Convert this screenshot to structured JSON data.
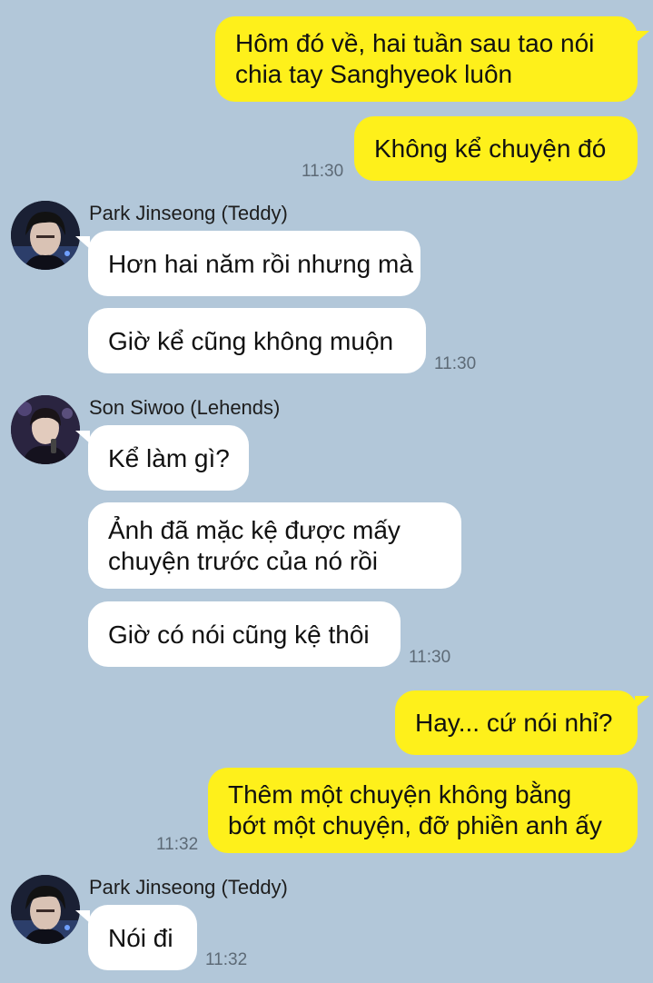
{
  "messages": [
    {
      "text": "Hôm đó về, hai tuần sau tao nói\nchia tay Sanghyeok luôn"
    },
    {
      "text": "Không kể chuyện đó",
      "time": "11:30"
    },
    {
      "sender": "Park Jinseong (Teddy)",
      "text": "Hơn hai năm rồi nhưng mà"
    },
    {
      "text": "Giờ kể cũng không muộn",
      "time": "11:30"
    },
    {
      "sender": "Son Siwoo (Lehends)",
      "text": "Kể làm gì?"
    },
    {
      "text": "Ảnh đã mặc kệ được mấy\nchuyện trước của nó rồi"
    },
    {
      "text": "Giờ có nói cũng kệ thôi",
      "time": "11:30"
    },
    {
      "text": "Hay... cứ nói nhỉ?"
    },
    {
      "text": "Thêm một chuyện không bằng\nbớt một chuyện, đỡ phiền anh ấy",
      "time": "11:32"
    },
    {
      "sender": "Park Jinseong (Teddy)",
      "text": "Nói đi",
      "time": "11:32"
    }
  ],
  "colors": {
    "background": "#b2c7d9",
    "outgoing_bubble": "#fef01b",
    "incoming_bubble": "#ffffff",
    "timestamp": "#5d6a76"
  },
  "icons": {
    "avatar_teddy": "avatar-icon",
    "avatar_lehends": "avatar-icon"
  }
}
